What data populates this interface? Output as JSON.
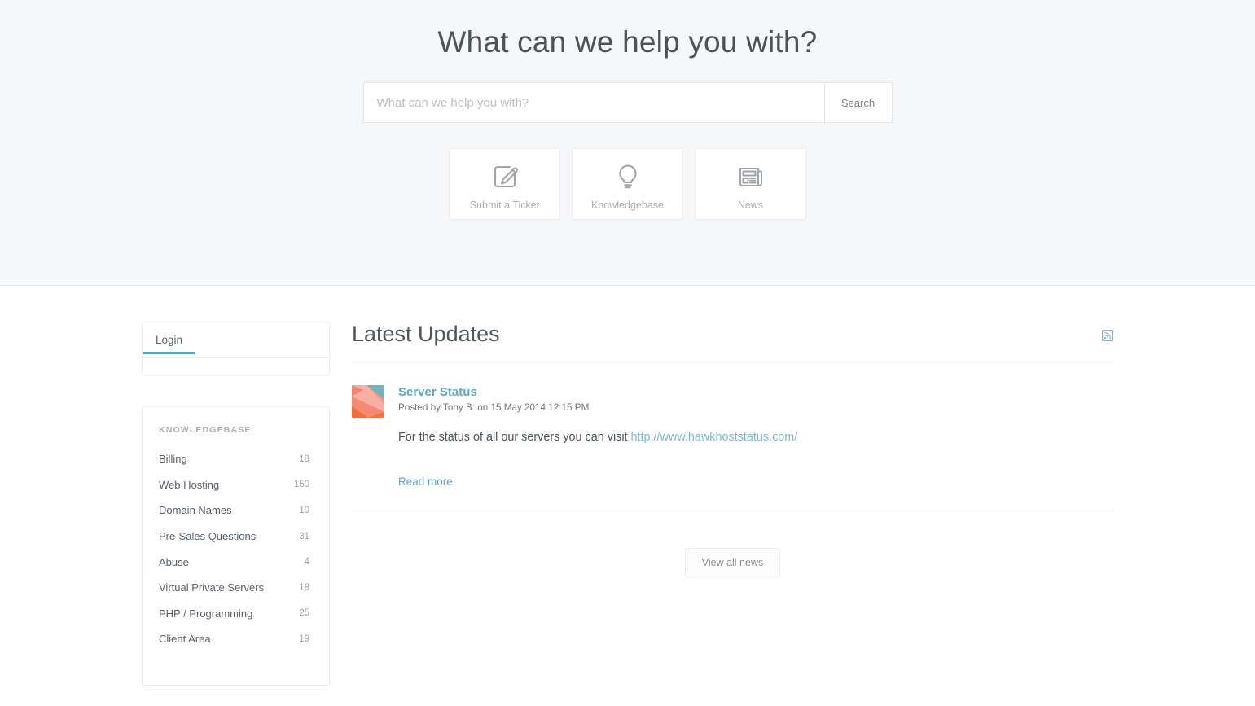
{
  "hero": {
    "title": "What can we help you with?",
    "search": {
      "placeholder": "What can we help you with?",
      "value": "",
      "button_label": "Search"
    },
    "cards": [
      {
        "label": "Submit a Ticket",
        "icon": "pencil-square-icon"
      },
      {
        "label": "Knowledgebase",
        "icon": "lightbulb-icon"
      },
      {
        "label": "News",
        "icon": "newspaper-icon"
      }
    ]
  },
  "sidebar": {
    "login_tab": "Login",
    "knowledgebase": {
      "heading": "KNOWLEDGEBASE",
      "items": [
        {
          "name": "Billing",
          "count": "18"
        },
        {
          "name": "Web Hosting",
          "count": "150"
        },
        {
          "name": "Domain Names",
          "count": "10"
        },
        {
          "name": "Pre-Sales Questions",
          "count": "31"
        },
        {
          "name": "Abuse",
          "count": "4"
        },
        {
          "name": "Virtual Private Servers",
          "count": "18"
        },
        {
          "name": "PHP / Programming",
          "count": "25"
        },
        {
          "name": "Client Area",
          "count": "19"
        }
      ]
    }
  },
  "main": {
    "title": "Latest Updates",
    "rss_icon": "rss-feed-icon",
    "news": [
      {
        "title": "Server Status",
        "meta": "Posted by Tony B. on 15 May 2014 12:15 PM",
        "text_before_link": "For the status of all our servers you can visit ",
        "link_text": "http://www.hawkhoststatus.com/",
        "read_more": "Read more"
      }
    ],
    "view_all_label": "View all news"
  },
  "colors": {
    "accent_teal": "#5ba4b5",
    "link_teal": "#5fa8bb",
    "hero_background": "#f6f7f8",
    "body_text": "#4b5358",
    "muted_text": "#a8aeb2"
  }
}
